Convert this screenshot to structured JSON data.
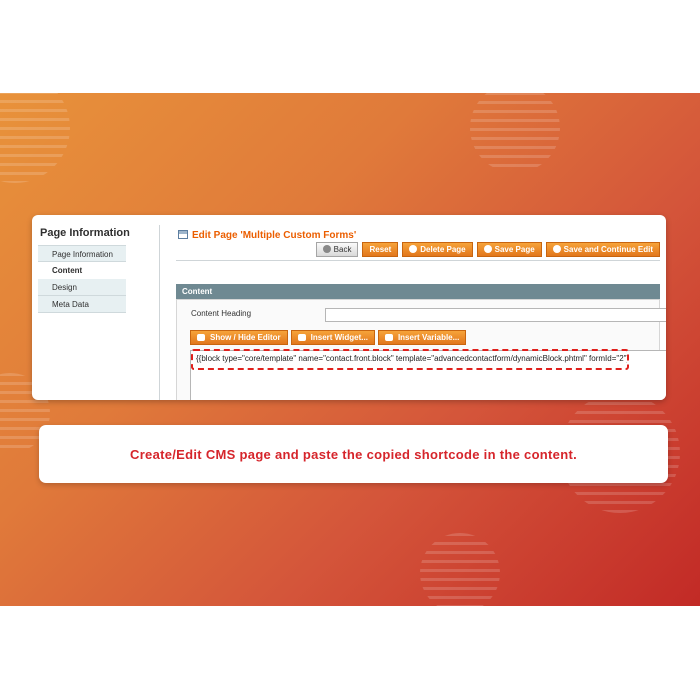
{
  "colors": {
    "accent": "#eb5e00",
    "caption_red": "#d6252b",
    "section_head_bg": "#6f8992"
  },
  "sidebar": {
    "title": "Page Information",
    "items": [
      {
        "label": "Page Information",
        "active": false
      },
      {
        "label": "Content",
        "active": true
      },
      {
        "label": "Design",
        "active": false
      },
      {
        "label": "Meta Data",
        "active": false
      }
    ]
  },
  "header": {
    "title": "Edit Page 'Multiple Custom Forms'",
    "buttons": {
      "back": "Back",
      "reset": "Reset",
      "delete": "Delete Page",
      "save": "Save Page",
      "save_continue": "Save and Continue Edit"
    }
  },
  "content": {
    "section_title": "Content",
    "heading_label": "Content Heading",
    "heading_value": "",
    "editor_buttons": {
      "show_hide": "Show / Hide Editor",
      "insert_widget": "Insert Widget...",
      "insert_variable": "Insert Variable..."
    },
    "shortcode": "{{block type=\"core/template\" name=\"contact.front.block\" template=\"advancedcontactform/dynamicBlock.phtml\" formId=\"2\"}}"
  },
  "caption": "Create/Edit CMS page and paste the copied shortcode in the content."
}
